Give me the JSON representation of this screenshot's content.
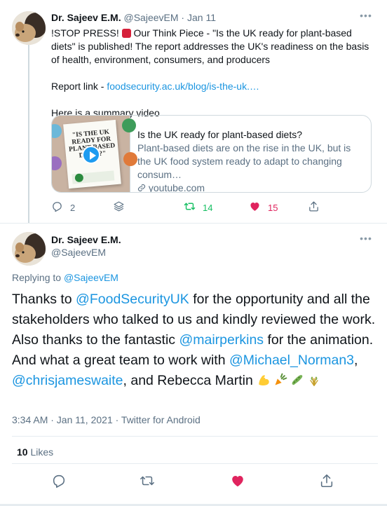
{
  "tweet1": {
    "author_name": "Dr. Sajeev E.M.",
    "author_handle": "@SajeevEM",
    "separator": "·",
    "date": "Jan 11",
    "text_part1": "!STOP PRESS!",
    "text_part2": "Our Think Piece - \"Is the UK ready for plant-based diets\" is published! The report addresses the UK's readiness on the basis of health, environment, consumers, and producers",
    "report_label": "Report link -",
    "report_link": "foodsecurity.ac.uk/blog/is-the-uk.…",
    "summary": "Here is a summary video",
    "card": {
      "thumb_title": "\"IS THE UK READY FOR PLANT-BASED DIETS?\"",
      "title": "Is the UK ready for plant-based diets?",
      "description": "Plant-based diets are on the rise in the UK, but is the UK food system ready to adapt to changing consum…",
      "domain_icon": "link-icon",
      "domain": "youtube.com"
    },
    "stats": {
      "replies": "2",
      "retweets": "14",
      "likes": "15"
    },
    "colors": {
      "retweet_active": "#17bf63",
      "like_active": "#e0245e"
    }
  },
  "tweet2": {
    "author_name": "Dr. Sajeev E.M.",
    "author_handle": "@SajeevEM",
    "replying_label": "Replying to",
    "replying_handle": "@SajeevEM",
    "t1": "Thanks to ",
    "m1": "@FoodSecurityUK",
    "t2": " for the opportunity and all the stakeholders who talked to us and kindly reviewed the work. Also thanks to the fantastic ",
    "m2": "@mairperkins",
    "t3": " for the animation. And what a great team to work with ",
    "m3": "@Michael_Norman3",
    "t4": ", ",
    "m4": "@chrisjameswaite",
    "t5": ", and Rebecca Martin ",
    "emojis": [
      "flexed-biceps-icon",
      "carrot-icon",
      "cucumber-icon",
      "sheaf-of-rice-icon"
    ],
    "time": "3:34 AM · Jan 11, 2021 · Twitter for Android",
    "likes_count": "10",
    "likes_label": "Likes"
  },
  "theme": {
    "link": "#1b95e0",
    "muted": "#5b7083",
    "border": "#e6ecf0"
  }
}
